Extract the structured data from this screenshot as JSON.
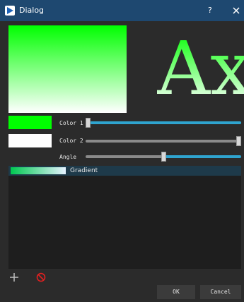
{
  "window": {
    "title": "Dialog",
    "help_label": "?",
    "close_icon": "close-icon",
    "accent": "#1e4870"
  },
  "preview": {
    "sample_text": "Ax",
    "gradient_colors": [
      "#00ff00",
      "#ffffff"
    ]
  },
  "controls": {
    "color1": {
      "label": "Color 1",
      "swatch": "#00ff00",
      "slider_value": 0.0
    },
    "color2": {
      "label": "Color 2",
      "swatch": "#ffffff",
      "slider_value": 1.0
    },
    "angle": {
      "label": "Angle",
      "slider_value": 0.5
    }
  },
  "gradient_list": {
    "items": [
      {
        "label": "Gradient",
        "colors": [
          "#00c850",
          "#e6f2ff"
        ]
      }
    ]
  },
  "toolbar": {
    "add_icon": "plus-icon",
    "remove_icon": "prohibited-icon"
  },
  "buttons": {
    "ok_label": "OK",
    "cancel_label": "Cancel"
  }
}
